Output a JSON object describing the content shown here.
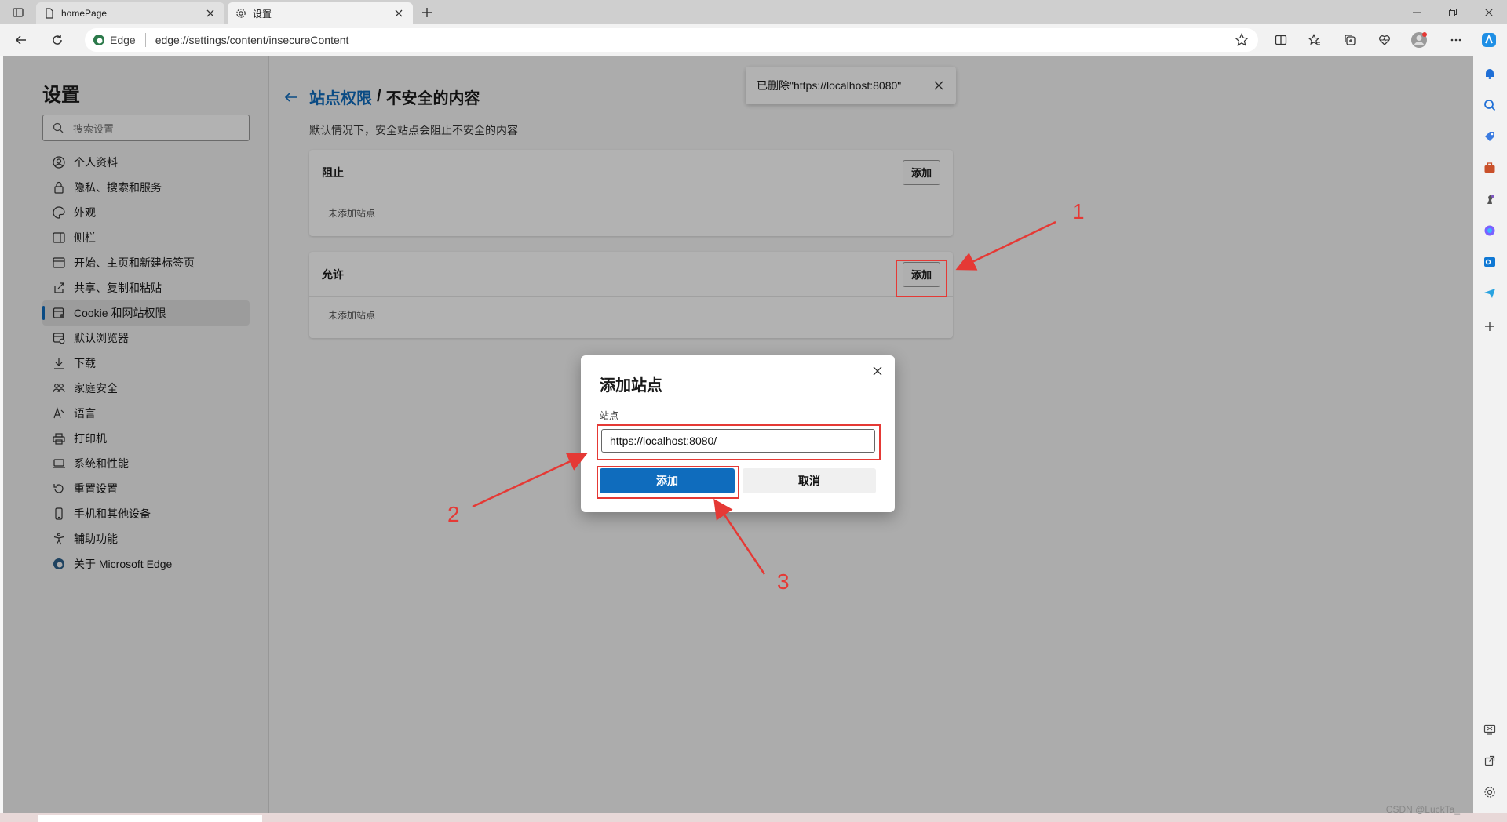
{
  "tabs": [
    {
      "title": "homePage"
    },
    {
      "title": "设置"
    }
  ],
  "toolbar": {
    "brand": "Edge",
    "url": "edge://settings/content/insecureContent"
  },
  "settings": {
    "title": "设置",
    "search_placeholder": "搜索设置",
    "nav": [
      {
        "label": "个人资料",
        "icon": "profile-icon"
      },
      {
        "label": "隐私、搜索和服务",
        "icon": "lock-icon"
      },
      {
        "label": "外观",
        "icon": "palette-icon"
      },
      {
        "label": "侧栏",
        "icon": "sidebar-icon"
      },
      {
        "label": "开始、主页和新建标签页",
        "icon": "home-icon"
      },
      {
        "label": "共享、复制和粘贴",
        "icon": "share-icon"
      },
      {
        "label": "Cookie 和网站权限",
        "icon": "cookie-icon",
        "active": true
      },
      {
        "label": "默认浏览器",
        "icon": "browser-icon"
      },
      {
        "label": "下载",
        "icon": "download-icon"
      },
      {
        "label": "家庭安全",
        "icon": "family-icon"
      },
      {
        "label": "语言",
        "icon": "language-icon"
      },
      {
        "label": "打印机",
        "icon": "printer-icon"
      },
      {
        "label": "系统和性能",
        "icon": "laptop-icon"
      },
      {
        "label": "重置设置",
        "icon": "reset-icon"
      },
      {
        "label": "手机和其他设备",
        "icon": "phone-icon"
      },
      {
        "label": "辅助功能",
        "icon": "accessibility-icon"
      },
      {
        "label": "关于 Microsoft Edge",
        "icon": "edge-icon"
      }
    ]
  },
  "content": {
    "crumb_link": "站点权限",
    "crumb_sep": "/",
    "crumb_current": "不安全的内容",
    "description": "默认情况下，安全站点会阻止不安全的内容",
    "block": {
      "title": "阻止",
      "add_label": "添加",
      "empty": "未添加站点"
    },
    "allow": {
      "title": "允许",
      "add_label": "添加",
      "empty": "未添加站点"
    }
  },
  "toast": {
    "text": "已删除\"https://localhost:8080\""
  },
  "dialog": {
    "title": "添加站点",
    "label": "站点",
    "value": "https://localhost:8080/",
    "add_label": "添加",
    "cancel_label": "取消"
  },
  "annotations": [
    "1",
    "2",
    "3"
  ],
  "colors": {
    "accent": "#0f6cbd",
    "annotation": "#e53935"
  },
  "watermark": "CSDN @LuckTa_"
}
